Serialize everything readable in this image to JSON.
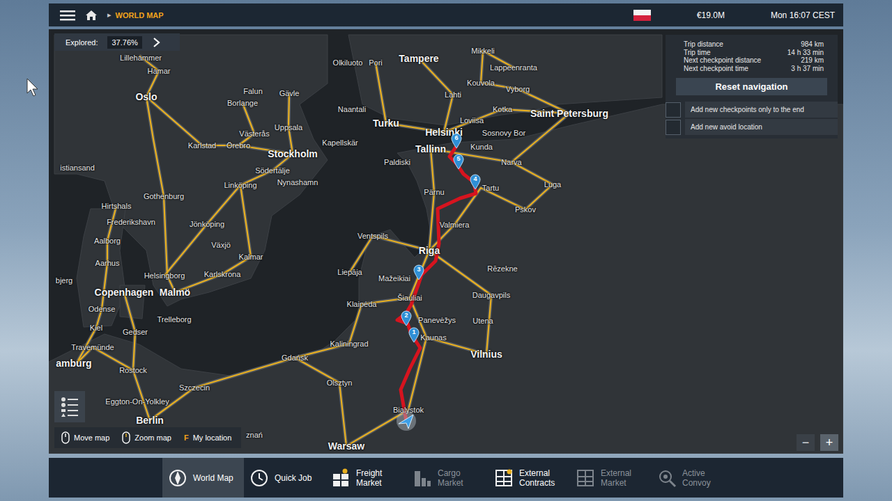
{
  "top_bar": {
    "separator": "▸",
    "title": "WORLD MAP",
    "money": "€19.0M",
    "clock": "Mon 16:07 CEST"
  },
  "explored": {
    "label": "Explored:",
    "value": "37.76%"
  },
  "trip": [
    {
      "label": "Trip distance",
      "value": "984 km"
    },
    {
      "label": "Trip time",
      "value": "14 h 33 min"
    },
    {
      "label": "Next checkpoint distance",
      "value": "219 km"
    },
    {
      "label": "Next checkpoint time",
      "value": "3 h 37 min"
    }
  ],
  "reset_button": "Reset navigation",
  "options": [
    {
      "label": "Add new checkpoints only to the end",
      "checked": false
    },
    {
      "label": "Add new avoid location",
      "checked": false
    }
  ],
  "map": {
    "cities": [
      {
        "name": "Lillehammer",
        "kind": "city"
      },
      {
        "name": "Hamar",
        "kind": "city"
      },
      {
        "name": "Oslo",
        "kind": "capital"
      },
      {
        "name": "Falun",
        "kind": "city"
      },
      {
        "name": "Gävle",
        "kind": "city"
      },
      {
        "name": "Borlange",
        "kind": "city"
      },
      {
        "name": "Västerås",
        "kind": "city"
      },
      {
        "name": "Uppsala",
        "kind": "city"
      },
      {
        "name": "Karlstad",
        "kind": "city"
      },
      {
        "name": "Örebro",
        "kind": "city"
      },
      {
        "name": "Stockholm",
        "kind": "capital"
      },
      {
        "name": "Kapellskär",
        "kind": "city"
      },
      {
        "name": "Södertälje",
        "kind": "city"
      },
      {
        "name": "Nynashamn",
        "kind": "city"
      },
      {
        "name": "istiansand",
        "kind": "city"
      },
      {
        "name": "Linköping",
        "kind": "city"
      },
      {
        "name": "Gothenburg",
        "kind": "city"
      },
      {
        "name": "Hirtshals",
        "kind": "city"
      },
      {
        "name": "Frederikshavn",
        "kind": "city"
      },
      {
        "name": "Jönköping",
        "kind": "city"
      },
      {
        "name": "Växjö",
        "kind": "city"
      },
      {
        "name": "Aalborg",
        "kind": "city"
      },
      {
        "name": "Kalmar",
        "kind": "city"
      },
      {
        "name": "Aarhus",
        "kind": "city"
      },
      {
        "name": "Karlskrona",
        "kind": "city"
      },
      {
        "name": "Helsingborg",
        "kind": "city"
      },
      {
        "name": "bjerg",
        "kind": "city"
      },
      {
        "name": "Copenhagen",
        "kind": "capital"
      },
      {
        "name": "Malmö",
        "kind": "capital"
      },
      {
        "name": "Odense",
        "kind": "city"
      },
      {
        "name": "Trelleborg",
        "kind": "city"
      },
      {
        "name": "Kiel",
        "kind": "city"
      },
      {
        "name": "Gedser",
        "kind": "city"
      },
      {
        "name": "Travemünde",
        "kind": "city"
      },
      {
        "name": "Rostock",
        "kind": "city"
      },
      {
        "name": "amburg",
        "kind": "capital"
      },
      {
        "name": "Szczecin",
        "kind": "city"
      },
      {
        "name": "Eggton-On-Yolkley",
        "kind": "city"
      },
      {
        "name": "Berlin",
        "kind": "capital"
      },
      {
        "name": "Gdańsk",
        "kind": "city"
      },
      {
        "name": "Olsztyn",
        "kind": "city"
      },
      {
        "name": "Kaliningrad",
        "kind": "city"
      },
      {
        "name": "Klaipėda",
        "kind": "city"
      },
      {
        "name": "Liepāja",
        "kind": "city"
      },
      {
        "name": "Ventspils",
        "kind": "city"
      },
      {
        "name": "Mažeikiai",
        "kind": "city"
      },
      {
        "name": "Šiauliai",
        "kind": "city"
      },
      {
        "name": "Panevėžys",
        "kind": "city"
      },
      {
        "name": "Kaunas",
        "kind": "city"
      },
      {
        "name": "Vilnius",
        "kind": "capital"
      },
      {
        "name": "Utena",
        "kind": "city"
      },
      {
        "name": "Daugavpils",
        "kind": "city"
      },
      {
        "name": "Rēzekne",
        "kind": "city"
      },
      {
        "name": "Riga",
        "kind": "capital"
      },
      {
        "name": "Valmiera",
        "kind": "city"
      },
      {
        "name": "Pärnu",
        "kind": "city"
      },
      {
        "name": "Tartu",
        "kind": "city"
      },
      {
        "name": "Pskov",
        "kind": "city"
      },
      {
        "name": "Luga",
        "kind": "city"
      },
      {
        "name": "Narva",
        "kind": "city"
      },
      {
        "name": "Kunda",
        "kind": "city"
      },
      {
        "name": "Paldiski",
        "kind": "city"
      },
      {
        "name": "Tallinn",
        "kind": "capital"
      },
      {
        "name": "Helsinki",
        "kind": "capital"
      },
      {
        "name": "Sosnovy Bor",
        "kind": "city"
      },
      {
        "name": "Loviisa",
        "kind": "city"
      },
      {
        "name": "Kotka",
        "kind": "city"
      },
      {
        "name": "Turku",
        "kind": "capital"
      },
      {
        "name": "Naantali",
        "kind": "city"
      },
      {
        "name": "Lahti",
        "kind": "city"
      },
      {
        "name": "Kouvola",
        "kind": "city"
      },
      {
        "name": "Vyborg",
        "kind": "city"
      },
      {
        "name": "Lappeenranta",
        "kind": "city"
      },
      {
        "name": "Mikkeli",
        "kind": "city"
      },
      {
        "name": "Tampere",
        "kind": "capital"
      },
      {
        "name": "Pori",
        "kind": "city"
      },
      {
        "name": "Olkiluoto",
        "kind": "city"
      },
      {
        "name": "Saint Petersburg",
        "kind": "capital"
      },
      {
        "name": "Bialystok",
        "kind": "city"
      },
      {
        "name": "Warsaw",
        "kind": "capital"
      },
      {
        "name": "znań",
        "kind": "city"
      }
    ],
    "checkpoints": [
      "1",
      "2",
      "3",
      "4",
      "5",
      "6"
    ]
  },
  "controls": [
    {
      "kind": "mouse",
      "key": "",
      "label": "Move map"
    },
    {
      "kind": "mouse",
      "key": "",
      "label": "Zoom map"
    },
    {
      "kind": "key",
      "key": "F",
      "label": "My location"
    }
  ],
  "zoom": {
    "out": "−",
    "in": "+"
  },
  "nav": [
    {
      "label": "World Map",
      "selected": true,
      "disabled": false
    },
    {
      "label": "Quick Job",
      "selected": false,
      "disabled": false
    },
    {
      "label": "Freight Market",
      "selected": false,
      "disabled": false
    },
    {
      "label": "Cargo Market",
      "selected": false,
      "disabled": true
    },
    {
      "label": "External Contracts",
      "selected": false,
      "disabled": false
    },
    {
      "label": "External Market",
      "selected": false,
      "disabled": true
    },
    {
      "label": "Active Convoy",
      "selected": false,
      "disabled": true
    }
  ]
}
